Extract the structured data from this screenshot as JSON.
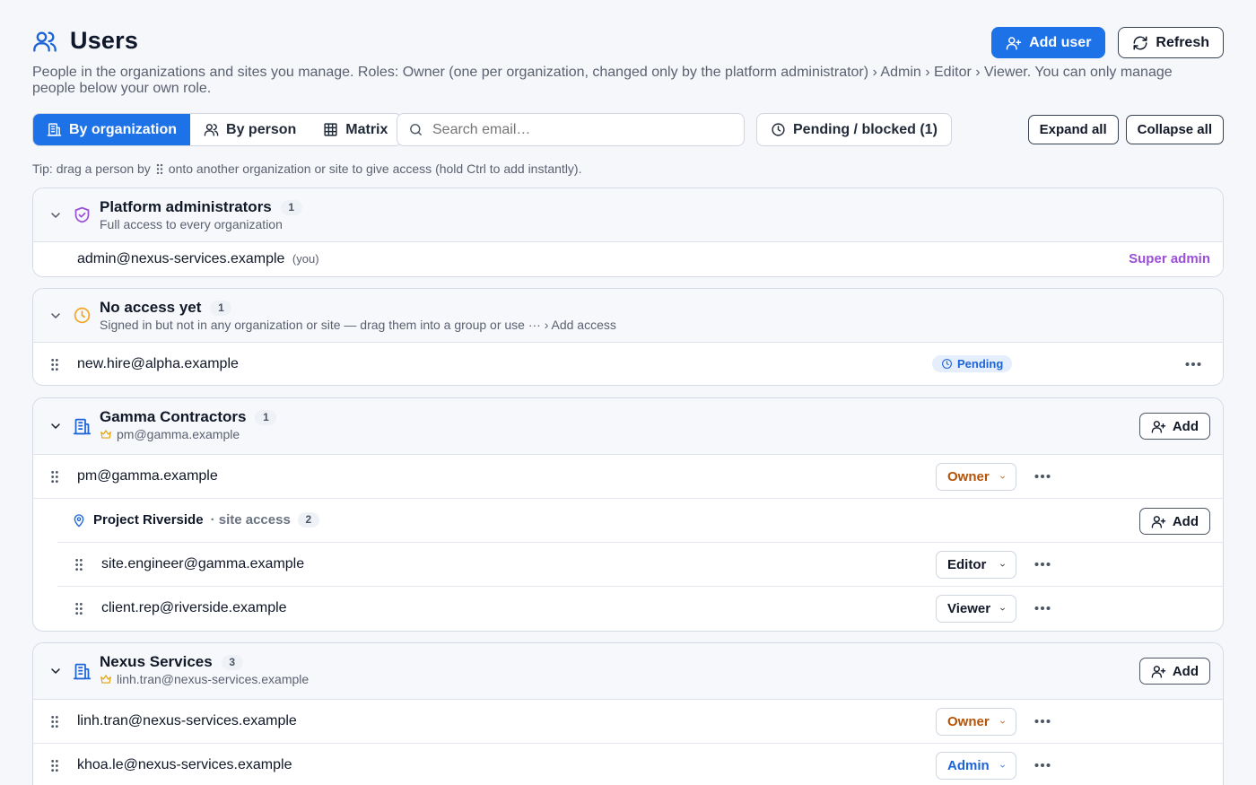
{
  "header": {
    "title": "Users",
    "add_user_label": "Add user",
    "refresh_label": "Refresh",
    "description": "People in the organizations and sites you manage. Roles: Owner (one per organization, changed only by the platform administrator) › Admin › Editor › Viewer. You can only manage people below your own role."
  },
  "toolbar": {
    "views": [
      {
        "label": "By organization",
        "active": true
      },
      {
        "label": "By person",
        "active": false
      },
      {
        "label": "Matrix",
        "active": false
      }
    ],
    "search_placeholder": "Search email…",
    "pending_label": "Pending / blocked (1)",
    "expand_all_label": "Expand all",
    "collapse_all_label": "Collapse all"
  },
  "tip": {
    "before": "Tip: drag a person by",
    "after": "onto another organization or site to give access (hold Ctrl to add instantly)."
  },
  "groups": {
    "platform": {
      "title": "Platform administrators",
      "count": "1",
      "subtitle": "Full access to every organization",
      "rows": [
        {
          "email": "admin@nexus-services.example",
          "note": "(you)",
          "role": "Super admin"
        }
      ]
    },
    "noaccess": {
      "title": "No access yet",
      "count": "1",
      "subtitle": "Signed in but not in any organization or site — drag them into a group or use ··· › Add access",
      "rows": [
        {
          "email": "new.hire@alpha.example",
          "status": "Pending"
        }
      ]
    },
    "gamma": {
      "title": "Gamma Contractors",
      "count": "1",
      "owner": "pm@gamma.example",
      "add_label": "Add",
      "rows": [
        {
          "email": "pm@gamma.example",
          "role": "Owner"
        }
      ],
      "site": {
        "name": "Project Riverside",
        "suffix": "· site access",
        "count": "2",
        "add_label": "Add",
        "rows": [
          {
            "email": "site.engineer@gamma.example",
            "role": "Editor"
          },
          {
            "email": "client.rep@riverside.example",
            "role": "Viewer"
          }
        ]
      }
    },
    "nexus": {
      "title": "Nexus Services",
      "count": "3",
      "owner": "linh.tran@nexus-services.example",
      "add_label": "Add",
      "rows": [
        {
          "email": "linh.tran@nexus-services.example",
          "role": "Owner"
        },
        {
          "email": "khoa.le@nexus-services.example",
          "role": "Admin"
        }
      ]
    }
  },
  "colors": {
    "primary": "#1d72e8",
    "owner": "#b45309",
    "admin": "#1d64d6",
    "super_admin": "#9a4fd6",
    "pending_bg": "#e4eefc",
    "clock_amber": "#f5a623"
  }
}
